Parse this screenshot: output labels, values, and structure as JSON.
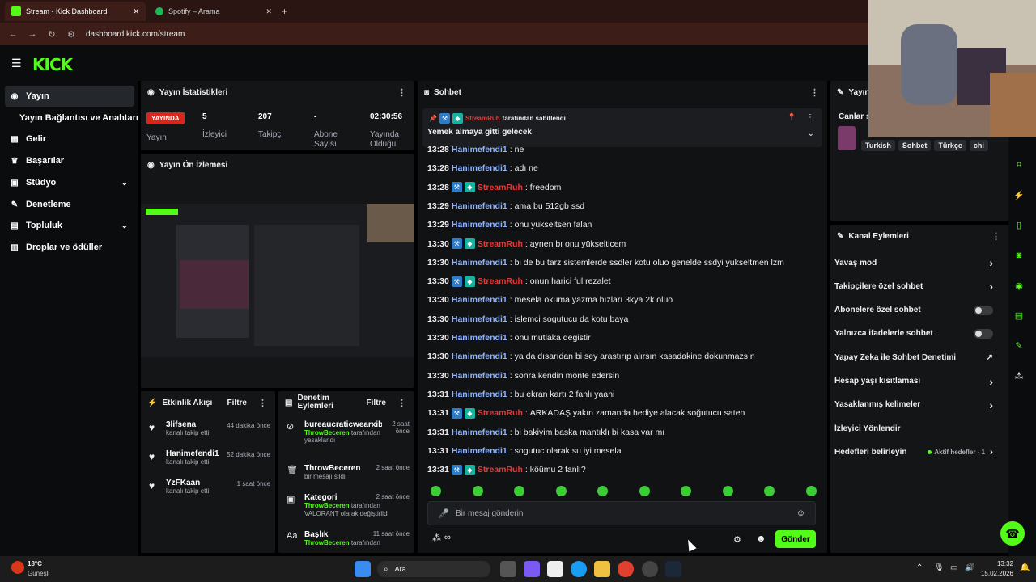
{
  "browser": {
    "tabs": [
      {
        "title": "Stream - Kick Dashboard"
      },
      {
        "title": "Spotify – Arama"
      }
    ],
    "url": "dashboard.kick.com/stream"
  },
  "logo": "KICK",
  "sidebar": {
    "items": [
      {
        "label": "Yayın"
      },
      {
        "label": "Yayın Bağlantısı ve Anahtarı"
      },
      {
        "label": "Gelir"
      },
      {
        "label": "Başarılar"
      },
      {
        "label": "Stüdyo"
      },
      {
        "label": "Denetleme"
      },
      {
        "label": "Topluluk"
      },
      {
        "label": "Droplar ve ödüller"
      }
    ]
  },
  "stats": {
    "title": "Yayın İstatistikleri",
    "live_badge": "YAYINDA",
    "stream_label": "Yayın",
    "viewers": {
      "value": "5",
      "label": "İzleyici"
    },
    "followers": {
      "value": "207",
      "label": "Takipçi"
    },
    "subs": {
      "value": "-",
      "label": "Abone Sayısı"
    },
    "uptime": {
      "value": "02:30:56",
      "label": "Yayında Olduğu"
    }
  },
  "preview": {
    "title": "Yayın Ön İzlemesi"
  },
  "activity": {
    "title": "Etkinlik Akışı",
    "filter": "Filtre",
    "items": [
      {
        "name": "3lifsena",
        "sub": "kanalı takip etti",
        "time": "44 dakika önce"
      },
      {
        "name": "Hanimefendi1",
        "sub": "kanalı takip etti",
        "time": "52 dakika önce"
      },
      {
        "name": "YzFKaan",
        "sub": "kanalı takip etti",
        "time": "1 saat önce"
      }
    ]
  },
  "moderation": {
    "title": "Denetim Eylemleri",
    "filter": "Filtre",
    "items": [
      {
        "name": "bureaucraticwearxibk",
        "actor": "ThrowBeceren",
        "rest": "tarafından yasaklandı",
        "time": "2 saat önce"
      },
      {
        "name": "ThrowBeceren",
        "actor": "",
        "rest": "bir mesajı sildi",
        "time": "2 saat önce"
      },
      {
        "name": "Kategori",
        "actor": "ThrowBeceren",
        "rest": "tarafından VALORANT olarak değiştirildi",
        "time": "2 saat önce"
      },
      {
        "name": "Başlık",
        "actor": "ThrowBeceren",
        "rest": "tarafından",
        "time": "11 saat önce"
      }
    ]
  },
  "chat": {
    "title": "Sohbet",
    "pinned_by": "StreamRuh",
    "pinned_suffix": "tarafından sabitlendi",
    "pinned_msg": "Yemek almaya gitti gelecek",
    "messages": [
      {
        "t": "13:28",
        "u": "Hanimefendi1",
        "m": "ne",
        "streamer": false
      },
      {
        "t": "13:28",
        "u": "Hanimefendi1",
        "m": "adı ne",
        "streamer": false
      },
      {
        "t": "13:28",
        "u": "StreamRuh",
        "m": "freedom",
        "streamer": true
      },
      {
        "t": "13:29",
        "u": "Hanimefendi1",
        "m": "ama bu 512gb ssd",
        "streamer": false
      },
      {
        "t": "13:29",
        "u": "Hanimefendi1",
        "m": "onu yukseltsen falan",
        "streamer": false
      },
      {
        "t": "13:30",
        "u": "StreamRuh",
        "m": "aynen bı onu yükselticem",
        "streamer": true
      },
      {
        "t": "13:30",
        "u": "Hanimefendi1",
        "m": "bi de bu tarz sistemlerde ssdler kotu oluo genelde ssdyi yukseltmen lzm",
        "streamer": false
      },
      {
        "t": "13:30",
        "u": "StreamRuh",
        "m": "onun harici ful rezalet",
        "streamer": true
      },
      {
        "t": "13:30",
        "u": "Hanimefendi1",
        "m": "mesela okuma yazma hızları 3kya 2k oluo",
        "streamer": false
      },
      {
        "t": "13:30",
        "u": "Hanimefendi1",
        "m": "islemci sogutucu da kotu baya",
        "streamer": false
      },
      {
        "t": "13:30",
        "u": "Hanimefendi1",
        "m": "onu mutlaka degistir",
        "streamer": false
      },
      {
        "t": "13:30",
        "u": "Hanimefendi1",
        "m": "ya da dısarıdan bi sey arastırıp alırsın kasadakine dokunmazsın",
        "streamer": false
      },
      {
        "t": "13:30",
        "u": "Hanimefendi1",
        "m": "sonra kendin monte edersin",
        "streamer": false
      },
      {
        "t": "13:31",
        "u": "Hanimefendi1",
        "m": "bu ekran kartı 2 fanlı yaani",
        "streamer": false
      },
      {
        "t": "13:31",
        "u": "StreamRuh",
        "m": "ARKADAŞ yakın zamanda hediye alacak soğutucu saten",
        "streamer": true
      },
      {
        "t": "13:31",
        "u": "Hanimefendi1",
        "m": "bi bakiyim baska mantıklı bi kasa var mı",
        "streamer": false
      },
      {
        "t": "13:31",
        "u": "Hanimefendi1",
        "m": "sogutuc olarak su iyi mesela",
        "streamer": false
      },
      {
        "t": "13:31",
        "u": "StreamRuh",
        "m": "köümu 2 fanlı?",
        "streamer": true
      }
    ],
    "input_placeholder": "Bir mesaj gönderin",
    "send": "Gönder",
    "points": "∞"
  },
  "right": {
    "stream_title": "Yayın bilgileri",
    "live_label": "Canlar s",
    "tags": [
      "Turkish",
      "Sohbet",
      "Türkçe",
      "chi"
    ],
    "actions_title": "Kanal Eylemleri",
    "actions": [
      {
        "label": "Yavaş mod",
        "kind": "chevron",
        "extra": ""
      },
      {
        "label": "Takipçilere özel sohbet",
        "kind": "chevron",
        "extra": ""
      },
      {
        "label": "Abonelere özel sohbet",
        "kind": "toggle",
        "extra": ""
      },
      {
        "label": "Yalnızca ifadelerle sohbet",
        "kind": "toggle",
        "extra": ""
      },
      {
        "label": "Yapay Zeka ile Sohbet Denetimi",
        "kind": "external",
        "extra": ""
      },
      {
        "label": "Hesap yaşı kısıtlaması",
        "kind": "chevron",
        "extra": ""
      },
      {
        "label": "Yasaklanmış kelimeler",
        "kind": "chevron",
        "extra": ""
      },
      {
        "label": "İzleyici Yönlendir",
        "kind": "none",
        "extra": ""
      },
      {
        "label": "Hedefleri belirleyin",
        "kind": "chevron",
        "extra": "Aktif hedefler - 1"
      }
    ]
  },
  "taskbar": {
    "weather_temp": "18°C",
    "weather_desc": "Güneşli",
    "search": "Ara",
    "time": "13:32",
    "date": "15.02.2026"
  },
  "colors": {
    "brand": "#53fc18",
    "live": "#d9261c",
    "username": "#8fb4ff",
    "streamer": "#e23b3b"
  }
}
